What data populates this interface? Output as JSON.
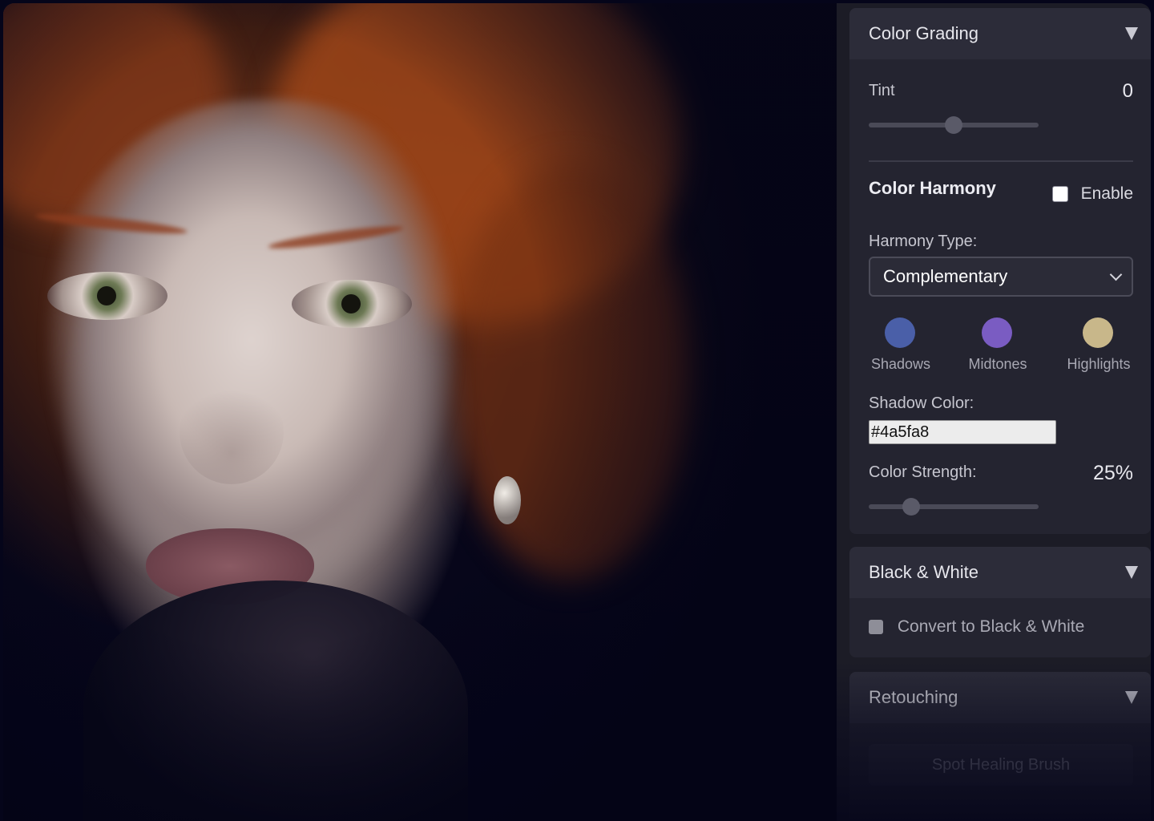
{
  "canvas": {
    "image_alt": "Portrait photo of a woman with red hair"
  },
  "color_grading": {
    "title": "Color Grading",
    "tint": {
      "label": "Tint",
      "value": "0",
      "slider_fraction": 0.5
    },
    "harmony": {
      "title": "Color Harmony",
      "enable_label": "Enable",
      "enabled": false,
      "type_label": "Harmony Type:",
      "type_value": "Complementary",
      "swatches": [
        {
          "label": "Shadows",
          "color": "#4a5fa8"
        },
        {
          "label": "Midtones",
          "color": "#7a5cc2"
        },
        {
          "label": "Highlights",
          "color": "#c8b78a"
        }
      ],
      "shadow_color_label": "Shadow Color:",
      "shadow_color_value": "#4a5fa8",
      "strength_label": "Color Strength:",
      "strength_value": "25%",
      "strength_fraction": 0.25
    }
  },
  "black_white": {
    "title": "Black & White",
    "convert_label": "Convert to Black & White",
    "checked": false
  },
  "retouching": {
    "title": "Retouching",
    "tool_button": "Spot Healing Brush"
  }
}
